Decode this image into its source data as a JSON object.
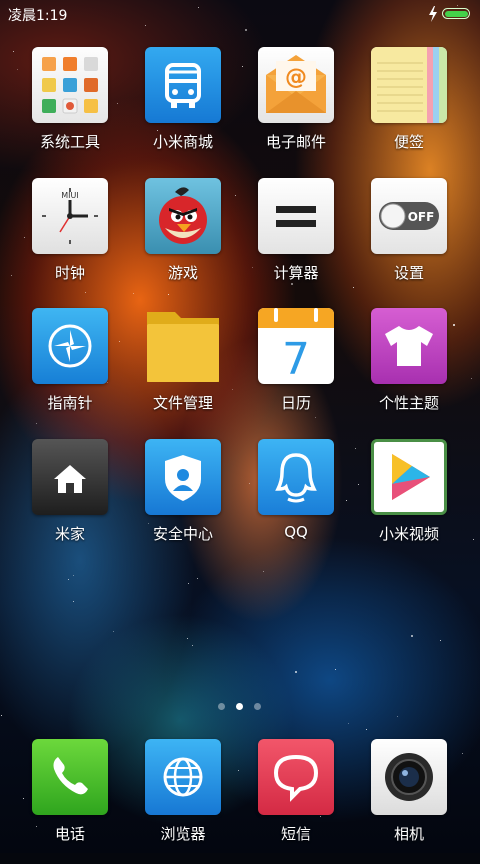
{
  "status_bar": {
    "time": "凌晨1:19",
    "battery_color": "#44d14a"
  },
  "apps": [
    {
      "name": "系统工具",
      "icon": "system-tools-icon"
    },
    {
      "name": "小米商城",
      "icon": "bus-icon"
    },
    {
      "name": "电子邮件",
      "icon": "email-icon"
    },
    {
      "name": "便签",
      "icon": "notes-icon"
    },
    {
      "name": "时钟",
      "icon": "clock-icon"
    },
    {
      "name": "游戏",
      "icon": "angry-bird-icon"
    },
    {
      "name": "计算器",
      "icon": "calculator-icon"
    },
    {
      "name": "设置",
      "icon": "settings-toggle-icon",
      "toggle_text": "OFF"
    },
    {
      "name": "指南针",
      "icon": "compass-icon"
    },
    {
      "name": "文件管理",
      "icon": "folder-icon"
    },
    {
      "name": "日历",
      "icon": "calendar-icon",
      "day": "7"
    },
    {
      "name": "个性主题",
      "icon": "tshirt-icon"
    },
    {
      "name": "米家",
      "icon": "home-icon"
    },
    {
      "name": "安全中心",
      "icon": "shield-icon"
    },
    {
      "name": "QQ",
      "icon": "qq-icon"
    },
    {
      "name": "小米视频",
      "icon": "play-icon"
    }
  ],
  "clock_brand": "MIUI",
  "page_indicator": {
    "count": 3,
    "active": 2
  },
  "dock": [
    {
      "name": "电话",
      "icon": "phone-icon"
    },
    {
      "name": "浏览器",
      "icon": "globe-icon"
    },
    {
      "name": "短信",
      "icon": "message-icon"
    },
    {
      "name": "相机",
      "icon": "camera-icon"
    }
  ]
}
